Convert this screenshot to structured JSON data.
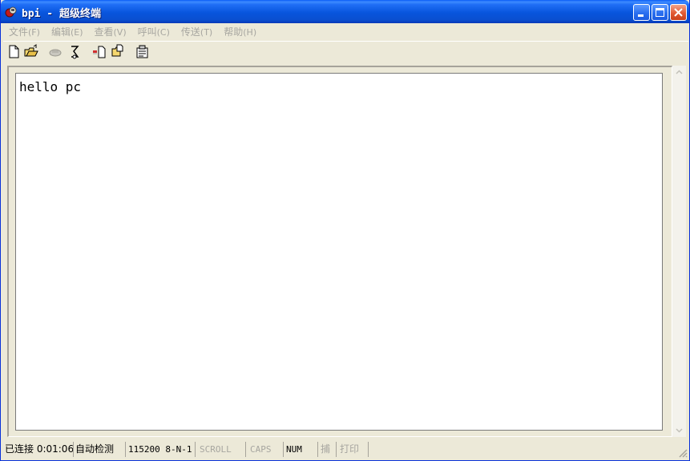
{
  "window": {
    "title": "bpi - 超级终端"
  },
  "menu": [
    {
      "label": "文件",
      "accel": "(F)"
    },
    {
      "label": "编辑",
      "accel": "(E)"
    },
    {
      "label": "查看",
      "accel": "(V)"
    },
    {
      "label": "呼叫",
      "accel": "(C)"
    },
    {
      "label": "传送",
      "accel": "(T)"
    },
    {
      "label": "帮助",
      "accel": "(H)"
    }
  ],
  "toolbar": {
    "icons": [
      "new-icon",
      "open-icon",
      "disconnect-icon",
      "dial-icon",
      "send-file-icon",
      "receive-file-icon",
      "properties-icon"
    ]
  },
  "terminal": {
    "text": "hello pc"
  },
  "statusbar": {
    "connection": "已连接 0:01:06",
    "detect": "自动检测",
    "port_settings": "115200 8-N-1",
    "scroll": "SCROLL",
    "caps": "CAPS",
    "num": "NUM",
    "capture": "捕",
    "print": "打印"
  },
  "colors": {
    "titlebar": "#0a4fd0",
    "chrome": "#ece9d8",
    "disabled_text": "#a7a6a0",
    "close_button": "#e25a34"
  }
}
